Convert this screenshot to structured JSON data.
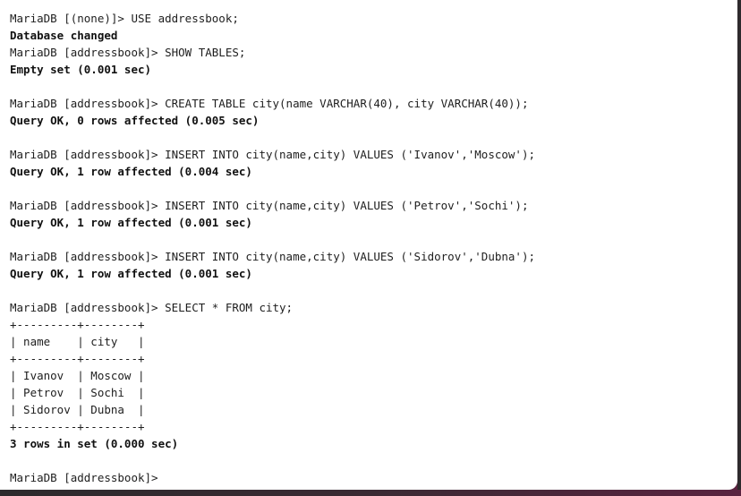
{
  "terminal": {
    "lines": [
      {
        "text": "MariaDB [(none)]> USE addressbook;",
        "bold": false
      },
      {
        "text": "Database changed",
        "bold": true
      },
      {
        "text": "MariaDB [addressbook]> SHOW TABLES;",
        "bold": false
      },
      {
        "text": "Empty set (0.001 sec)",
        "bold": true
      },
      {
        "text": "",
        "bold": false
      },
      {
        "text": "MariaDB [addressbook]> CREATE TABLE city(name VARCHAR(40), city VARCHAR(40));",
        "bold": false
      },
      {
        "text": "Query OK, 0 rows affected (0.005 sec)",
        "bold": true
      },
      {
        "text": "",
        "bold": false
      },
      {
        "text": "MariaDB [addressbook]> INSERT INTO city(name,city) VALUES ('Ivanov','Moscow');",
        "bold": false
      },
      {
        "text": "Query OK, 1 row affected (0.004 sec)",
        "bold": true
      },
      {
        "text": "",
        "bold": false
      },
      {
        "text": "MariaDB [addressbook]> INSERT INTO city(name,city) VALUES ('Petrov','Sochi');",
        "bold": false
      },
      {
        "text": "Query OK, 1 row affected (0.001 sec)",
        "bold": true
      },
      {
        "text": "",
        "bold": false
      },
      {
        "text": "MariaDB [addressbook]> INSERT INTO city(name,city) VALUES ('Sidorov','Dubna');",
        "bold": false
      },
      {
        "text": "Query OK, 1 row affected (0.001 sec)",
        "bold": true
      },
      {
        "text": "",
        "bold": false
      },
      {
        "text": "MariaDB [addressbook]> SELECT * FROM city;",
        "bold": false
      },
      {
        "text": "+---------+--------+",
        "bold": false
      },
      {
        "text": "| name    | city   |",
        "bold": false
      },
      {
        "text": "+---------+--------+",
        "bold": false
      },
      {
        "text": "| Ivanov  | Moscow |",
        "bold": false
      },
      {
        "text": "| Petrov  | Sochi  |",
        "bold": false
      },
      {
        "text": "| Sidorov | Dubna  |",
        "bold": false
      },
      {
        "text": "+---------+--------+",
        "bold": false
      },
      {
        "text": "3 rows in set (0.000 sec)",
        "bold": true
      },
      {
        "text": "",
        "bold": false
      },
      {
        "text": "MariaDB [addressbook]>",
        "bold": false
      }
    ]
  }
}
